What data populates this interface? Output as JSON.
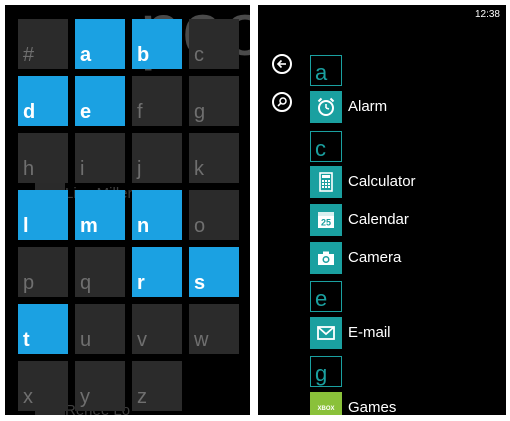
{
  "jump_list": {
    "background_text": "people",
    "background_names": [
      "Lisa Miller",
      "Renee Lo"
    ],
    "letters": [
      {
        "label": "#",
        "active": false
      },
      {
        "label": "a",
        "active": true
      },
      {
        "label": "b",
        "active": true
      },
      {
        "label": "c",
        "active": false
      },
      {
        "label": "d",
        "active": true
      },
      {
        "label": "e",
        "active": true
      },
      {
        "label": "f",
        "active": false
      },
      {
        "label": "g",
        "active": false
      },
      {
        "label": "h",
        "active": false
      },
      {
        "label": "i",
        "active": false
      },
      {
        "label": "j",
        "active": false
      },
      {
        "label": "k",
        "active": false
      },
      {
        "label": "l",
        "active": true
      },
      {
        "label": "m",
        "active": true
      },
      {
        "label": "n",
        "active": true
      },
      {
        "label": "o",
        "active": false
      },
      {
        "label": "p",
        "active": false
      },
      {
        "label": "q",
        "active": false
      },
      {
        "label": "r",
        "active": true
      },
      {
        "label": "s",
        "active": true
      },
      {
        "label": "t",
        "active": true
      },
      {
        "label": "u",
        "active": false
      },
      {
        "label": "v",
        "active": false
      },
      {
        "label": "w",
        "active": false
      },
      {
        "label": "x",
        "active": false
      },
      {
        "label": "y",
        "active": false
      },
      {
        "label": "z",
        "active": false
      }
    ],
    "colors": {
      "accent": "#1ba1e2",
      "inactive_tile": "#2b2b2b"
    }
  },
  "app_list": {
    "status_bar": {
      "time": "12:38"
    },
    "buttons": {
      "back_icon": "back-arrow-icon",
      "search_icon": "search-icon"
    },
    "groups": [
      {
        "header": "a",
        "apps": [
          {
            "name": "Alarm",
            "icon": "alarm-clock-icon"
          }
        ]
      },
      {
        "header": "c",
        "apps": [
          {
            "name": "Calculator",
            "icon": "calculator-icon"
          },
          {
            "name": "Calendar",
            "icon": "calendar-icon",
            "icon_text": "25"
          },
          {
            "name": "Camera",
            "icon": "camera-icon"
          }
        ]
      },
      {
        "header": "e",
        "apps": [
          {
            "name": "E-mail",
            "icon": "envelope-icon"
          }
        ]
      },
      {
        "header": "g",
        "apps": [
          {
            "name": "Games",
            "icon": "xbox-icon",
            "icon_text": "XBOX"
          }
        ]
      }
    ],
    "colors": {
      "accent": "#1aa0a0",
      "games_tile": "#8ac13a"
    }
  }
}
